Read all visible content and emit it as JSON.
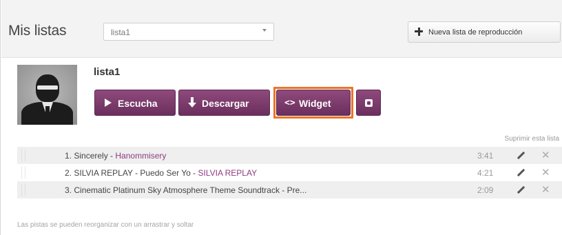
{
  "header": {
    "title": "Mis listas",
    "select_value": "lista1",
    "new_list_label": "Nueva lista de reproducción"
  },
  "playlist": {
    "name": "lista1",
    "buttons": {
      "listen": "Escucha",
      "download": "Descargar",
      "widget": "Widget",
      "widget_icon": "<>"
    },
    "delete_label": "Suprimir esta lista"
  },
  "tracks": [
    {
      "number": "1.",
      "title": "Sincerely",
      "artist": "Hanommisery",
      "duration": "3:41"
    },
    {
      "number": "2.",
      "title": "SILVIA REPLAY - Puedo Ser Yo",
      "artist": "SILVIA REPLAY",
      "duration": "4:21"
    },
    {
      "number": "3.",
      "title": "Cinematic Platinum Sky Atmosphere Theme Soundtrack - Pre...",
      "artist": "",
      "duration": "2:09"
    }
  ],
  "footnote": "Las pistas se pueden reorganizar con un arrastrar y soltar",
  "colors": {
    "accent": "#7a3a6a",
    "highlight": "#ee7324"
  }
}
